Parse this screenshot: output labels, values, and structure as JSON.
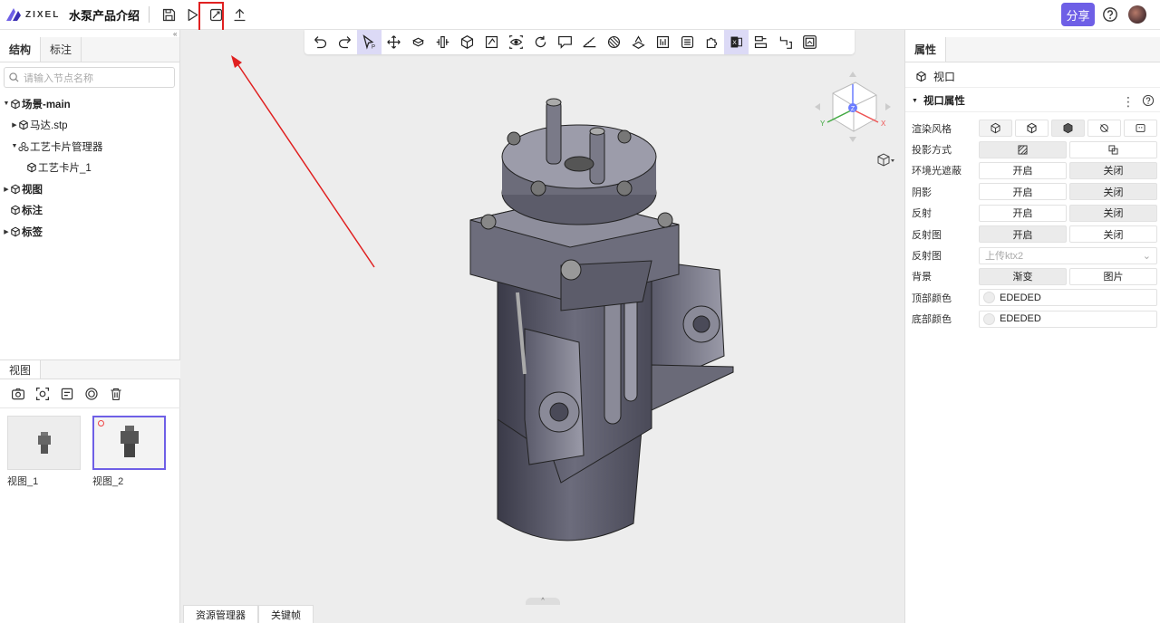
{
  "app": {
    "logo_text": "ZIXEL",
    "doc_title": "水泵产品介绍",
    "share_label": "分享"
  },
  "left": {
    "tabs": [
      "结构",
      "标注"
    ],
    "search_placeholder": "请输入节点名称",
    "tree": [
      {
        "label": "场景-main",
        "caret": "▼",
        "bold": true,
        "indent": 0
      },
      {
        "label": "马达.stp",
        "caret": "▶",
        "bold": false,
        "indent": 1
      },
      {
        "label": "工艺卡片管理器",
        "caret": "▼",
        "bold": false,
        "indent": 1
      },
      {
        "label": "工艺卡片_1",
        "caret": "",
        "bold": false,
        "indent": 2
      },
      {
        "label": "视图",
        "caret": "▶",
        "bold": true,
        "indent": 0
      },
      {
        "label": "标注",
        "caret": "",
        "bold": true,
        "indent": 0
      },
      {
        "label": "标签",
        "caret": "▶",
        "bold": true,
        "indent": 0
      }
    ],
    "views_tab": "视图",
    "views": [
      {
        "caption": "视图_1"
      },
      {
        "caption": "视图_2"
      }
    ]
  },
  "bottom_tabs": [
    "资源管理器",
    "关键帧"
  ],
  "right": {
    "tab": "属性",
    "header": "视口",
    "section": "视口属性",
    "props": {
      "render_style": "渲染风格",
      "projection": "投影方式",
      "ao": "环境光遮蔽",
      "shadow": "阴影",
      "reflection": "反射",
      "reflection_map": "反射图",
      "reflection_map2": "反射图",
      "background": "背景",
      "top_color": "顶部颜色",
      "bottom_color": "底部颜色"
    },
    "on": "开启",
    "off": "关闭",
    "upload_placeholder": "上传ktx2",
    "bg_gradient": "渐变",
    "bg_image": "图片",
    "top_color_value": "EDEDED",
    "bottom_color_value": "EDEDED"
  },
  "gizmo": {
    "z": "Z",
    "x": "X",
    "y": "Y"
  },
  "colors": {
    "accent": "#6e5fe6",
    "highlight": "#e02020",
    "canvas": "#ededed"
  }
}
